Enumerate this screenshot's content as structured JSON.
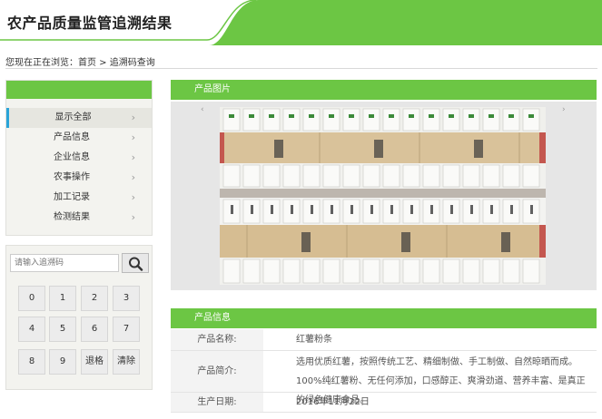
{
  "header": {
    "title": "农产品质量监管追溯结果"
  },
  "breadcrumb": {
    "text": "您现在正在浏览：首页 > 追溯码查询"
  },
  "nav": {
    "items": [
      {
        "label": "显示全部"
      },
      {
        "label": "产品信息"
      },
      {
        "label": "企业信息"
      },
      {
        "label": "农事操作"
      },
      {
        "label": "加工记录"
      },
      {
        "label": "检测结果"
      }
    ]
  },
  "search": {
    "placeholder": "请输入追溯码"
  },
  "keypad": {
    "keys": [
      "0",
      "1",
      "2",
      "3",
      "4",
      "5",
      "6",
      "7",
      "8",
      "9",
      "退格",
      "清除"
    ]
  },
  "product_image": {
    "heading": "产品图片"
  },
  "product_info": {
    "heading": "产品信息",
    "rows": [
      {
        "label": "产品名称:",
        "value": "红薯粉条"
      },
      {
        "label": "产品简介:",
        "value": "选用优质红薯，按照传统工艺、精细制做、手工制做、自然晾晒而成。100%纯红薯粉、无任何添加，口感醇正、爽滑劲道、营养丰富、是真正的绿色健康食品。"
      },
      {
        "label": "生产日期:",
        "value": "2016年11月22日"
      }
    ]
  },
  "colors": {
    "accent": "#6cc644",
    "active_marker": "#2aa4d8"
  },
  "icons": {
    "search": "search-icon",
    "nav_chevron": "chevron-right-icon",
    "slider_prev": "chevron-left-icon",
    "slider_next": "chevron-right-icon"
  }
}
